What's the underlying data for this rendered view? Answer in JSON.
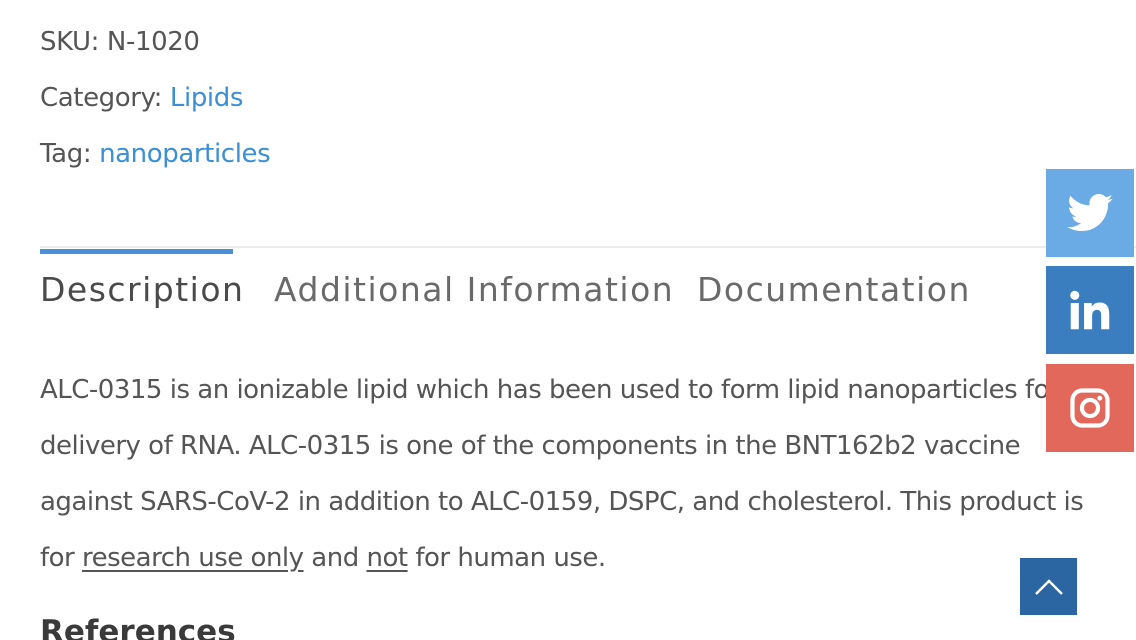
{
  "meta": {
    "sku_label": "SKU:",
    "sku_value": "N-1020",
    "category_label": "Category:",
    "category_link": "Lipids",
    "tag_label": "Tag:",
    "tag_link": "nanoparticles"
  },
  "tabs": [
    {
      "label": "Description",
      "active": true
    },
    {
      "label": "Additional Information",
      "active": false
    },
    {
      "label": "Documentation",
      "active": false
    }
  ],
  "description": {
    "line1": "ALC-0315 is an ionizable lipid which has been used to form lipid nanoparticles fo",
    "line2": "delivery of RNA. ALC-0315 is one of the components in the BNT162b2 vaccine",
    "line3": "against SARS-CoV-2 in addition to ALC-0159, DSPC, and cholesterol. This product is",
    "line4_part1": "for ",
    "line4_u1": "research use only",
    "line4_part2": " and ",
    "line4_u2": "not",
    "line4_part3": " for human use."
  },
  "references_heading": "References",
  "social": {
    "twitter_icon": "twitter-icon",
    "linkedin_icon": "linkedin-icon",
    "instagram_icon": "instagram-icon"
  },
  "colors": {
    "link": "#3b8fd4",
    "tab_indicator": "#4a90d9",
    "twitter": "#6aaae5",
    "linkedin": "#3a7ec0",
    "instagram": "#e1685a",
    "back_to_top": "#2b66a2"
  }
}
